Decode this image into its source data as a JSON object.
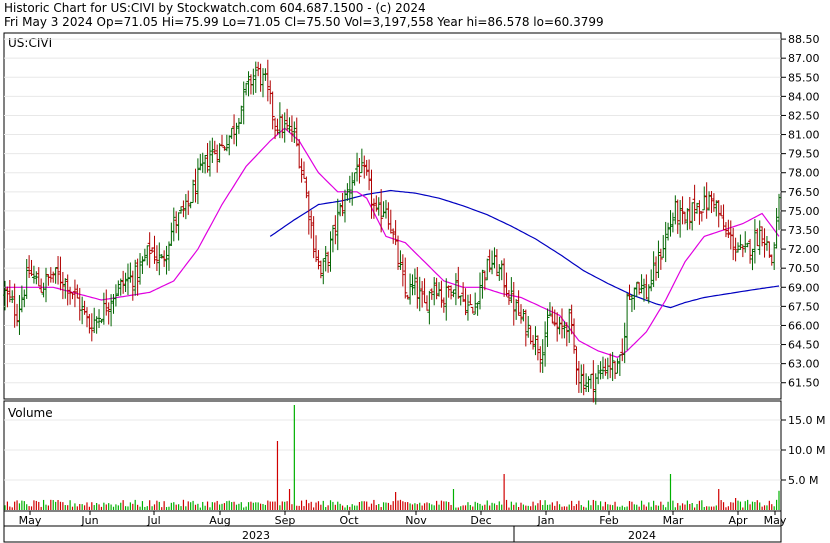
{
  "header": {
    "line1": "Historic Chart for US:CIVI by Stockwatch.com 604.687.1500 - (c) 2024",
    "line2": "Fri May  3 2024  Op=71.05  Hi=75.99  Lo=71.05  Cl=75.50  Vol=3,197,558  Year hi=86.578  lo=60.3799"
  },
  "colors": {
    "up": "#006400",
    "down": "#b00000",
    "ma_fast": "#e000e0",
    "ma_slow": "#0000c0",
    "vol_up": "#00b000",
    "vol_down": "#d00000"
  },
  "chart_data": [
    {
      "type": "line",
      "subtype": "ohlc",
      "symbol_label": "US:CIVI",
      "y_ticks": [
        "88.50",
        "87.00",
        "85.50",
        "84.00",
        "82.50",
        "81.00",
        "79.50",
        "78.00",
        "76.50",
        "75.00",
        "73.50",
        "72.00",
        "70.50",
        "69.00",
        "67.50",
        "66.00",
        "64.50",
        "63.00",
        "61.50"
      ],
      "ylim": [
        60.3,
        88.9
      ],
      "month_labels": [
        "May",
        "Jun",
        "Jul",
        "Aug",
        "Sep",
        "Oct",
        "Nov",
        "Dec",
        "Jan",
        "Feb",
        "Mar",
        "Apr",
        "May"
      ],
      "year_labels": [
        "2023",
        "2024"
      ],
      "price_anchors": [
        [
          0,
          68.5
        ],
        [
          5,
          67.0
        ],
        [
          10,
          70.2
        ],
        [
          15,
          69.0
        ],
        [
          20,
          70.0
        ],
        [
          25,
          69.5
        ],
        [
          30,
          68.0
        ],
        [
          35,
          66.0
        ],
        [
          40,
          67.0
        ],
        [
          45,
          68.5
        ],
        [
          50,
          69.5
        ],
        [
          55,
          70.0
        ],
        [
          60,
          72.0
        ],
        [
          65,
          71.0
        ],
        [
          70,
          74.0
        ],
        [
          75,
          75.0
        ],
        [
          80,
          77.5
        ],
        [
          85,
          79.5
        ],
        [
          90,
          80.0
        ],
        [
          95,
          81.5
        ],
        [
          100,
          84.5
        ],
        [
          104,
          86.0
        ],
        [
          108,
          85.0
        ],
        [
          112,
          82.0
        ],
        [
          116,
          81.5
        ],
        [
          120,
          81.0
        ],
        [
          124,
          77.5
        ],
        [
          128,
          72.5
        ],
        [
          131,
          70.0
        ],
        [
          134,
          71.5
        ],
        [
          138,
          74.5
        ],
        [
          142,
          76.5
        ],
        [
          146,
          78.5
        ],
        [
          150,
          77.5
        ],
        [
          154,
          74.5
        ],
        [
          158,
          75.5
        ],
        [
          162,
          72.0
        ],
        [
          166,
          68.5
        ],
        [
          170,
          69.0
        ],
        [
          174,
          67.5
        ],
        [
          178,
          69.5
        ],
        [
          182,
          68.0
        ],
        [
          186,
          69.5
        ],
        [
          190,
          68.0
        ],
        [
          194,
          67.0
        ],
        [
          198,
          70.0
        ],
        [
          202,
          71.0
        ],
        [
          206,
          70.0
        ],
        [
          210,
          68.0
        ],
        [
          214,
          66.5
        ],
        [
          218,
          65.5
        ],
        [
          222,
          64.0
        ],
        [
          226,
          66.5
        ],
        [
          230,
          65.5
        ],
        [
          234,
          66.5
        ],
        [
          238,
          62.0
        ],
        [
          242,
          61.5
        ],
        [
          246,
          62.0
        ],
        [
          250,
          63.0
        ],
        [
          254,
          62.5
        ],
        [
          256,
          63.5
        ],
        [
          258,
          68.0
        ],
        [
          262,
          69.5
        ],
        [
          266,
          68.5
        ],
        [
          270,
          70.5
        ],
        [
          274,
          73.0
        ],
        [
          278,
          75.0
        ],
        [
          282,
          74.0
        ],
        [
          286,
          75.5
        ],
        [
          290,
          75.5
        ],
        [
          294,
          76.0
        ],
        [
          298,
          73.5
        ],
        [
          302,
          72.5
        ],
        [
          306,
          71.5
        ],
        [
          310,
          72.5
        ],
        [
          314,
          73.5
        ],
        [
          318,
          71.0
        ],
        [
          321,
          75.5
        ]
      ],
      "ma_fast_anchors": [
        [
          0,
          69.0
        ],
        [
          20,
          69.0
        ],
        [
          40,
          68.0
        ],
        [
          60,
          68.6
        ],
        [
          70,
          69.5
        ],
        [
          80,
          72.0
        ],
        [
          90,
          75.5
        ],
        [
          100,
          78.5
        ],
        [
          110,
          80.5
        ],
        [
          116,
          81.5
        ],
        [
          122,
          80.5
        ],
        [
          130,
          78.0
        ],
        [
          138,
          76.5
        ],
        [
          146,
          76.5
        ],
        [
          150,
          76.0
        ],
        [
          158,
          73.0
        ],
        [
          166,
          72.5
        ],
        [
          174,
          71.0
        ],
        [
          182,
          69.5
        ],
        [
          190,
          69.0
        ],
        [
          198,
          69.0
        ],
        [
          206,
          68.5
        ],
        [
          214,
          68.2
        ],
        [
          222,
          67.5
        ],
        [
          230,
          66.8
        ],
        [
          238,
          64.8
        ],
        [
          246,
          64.0
        ],
        [
          254,
          63.5
        ],
        [
          258,
          64.0
        ],
        [
          266,
          65.5
        ],
        [
          274,
          68.0
        ],
        [
          282,
          71.0
        ],
        [
          290,
          73.0
        ],
        [
          298,
          73.5
        ],
        [
          306,
          74.0
        ],
        [
          314,
          74.8
        ],
        [
          321,
          73.0
        ]
      ],
      "ma_slow_anchors": [
        [
          110,
          73.0
        ],
        [
          120,
          74.3
        ],
        [
          130,
          75.5
        ],
        [
          140,
          75.8
        ],
        [
          150,
          76.3
        ],
        [
          160,
          76.6
        ],
        [
          170,
          76.4
        ],
        [
          180,
          76.0
        ],
        [
          190,
          75.4
        ],
        [
          200,
          74.7
        ],
        [
          210,
          73.8
        ],
        [
          220,
          72.8
        ],
        [
          230,
          71.6
        ],
        [
          240,
          70.3
        ],
        [
          250,
          69.3
        ],
        [
          260,
          68.4
        ],
        [
          270,
          67.7
        ],
        [
          276,
          67.4
        ],
        [
          282,
          67.8
        ],
        [
          290,
          68.2
        ],
        [
          300,
          68.5
        ],
        [
          310,
          68.8
        ],
        [
          321,
          69.1
        ]
      ],
      "volume_y_ticks": [
        "15.0 M",
        "10.0 M",
        "5.0 M"
      ],
      "volume_label": "Volume",
      "volume_ylim": [
        0,
        18
      ],
      "volume_spikes": [
        [
          113,
          11.5
        ],
        [
          120,
          17.5
        ],
        [
          118,
          3.5
        ],
        [
          162,
          3.0
        ],
        [
          186,
          3.5
        ],
        [
          207,
          6.0
        ],
        [
          276,
          6.0
        ],
        [
          296,
          3.5
        ],
        [
          303,
          2.0
        ],
        [
          321,
          3.2
        ]
      ]
    }
  ]
}
